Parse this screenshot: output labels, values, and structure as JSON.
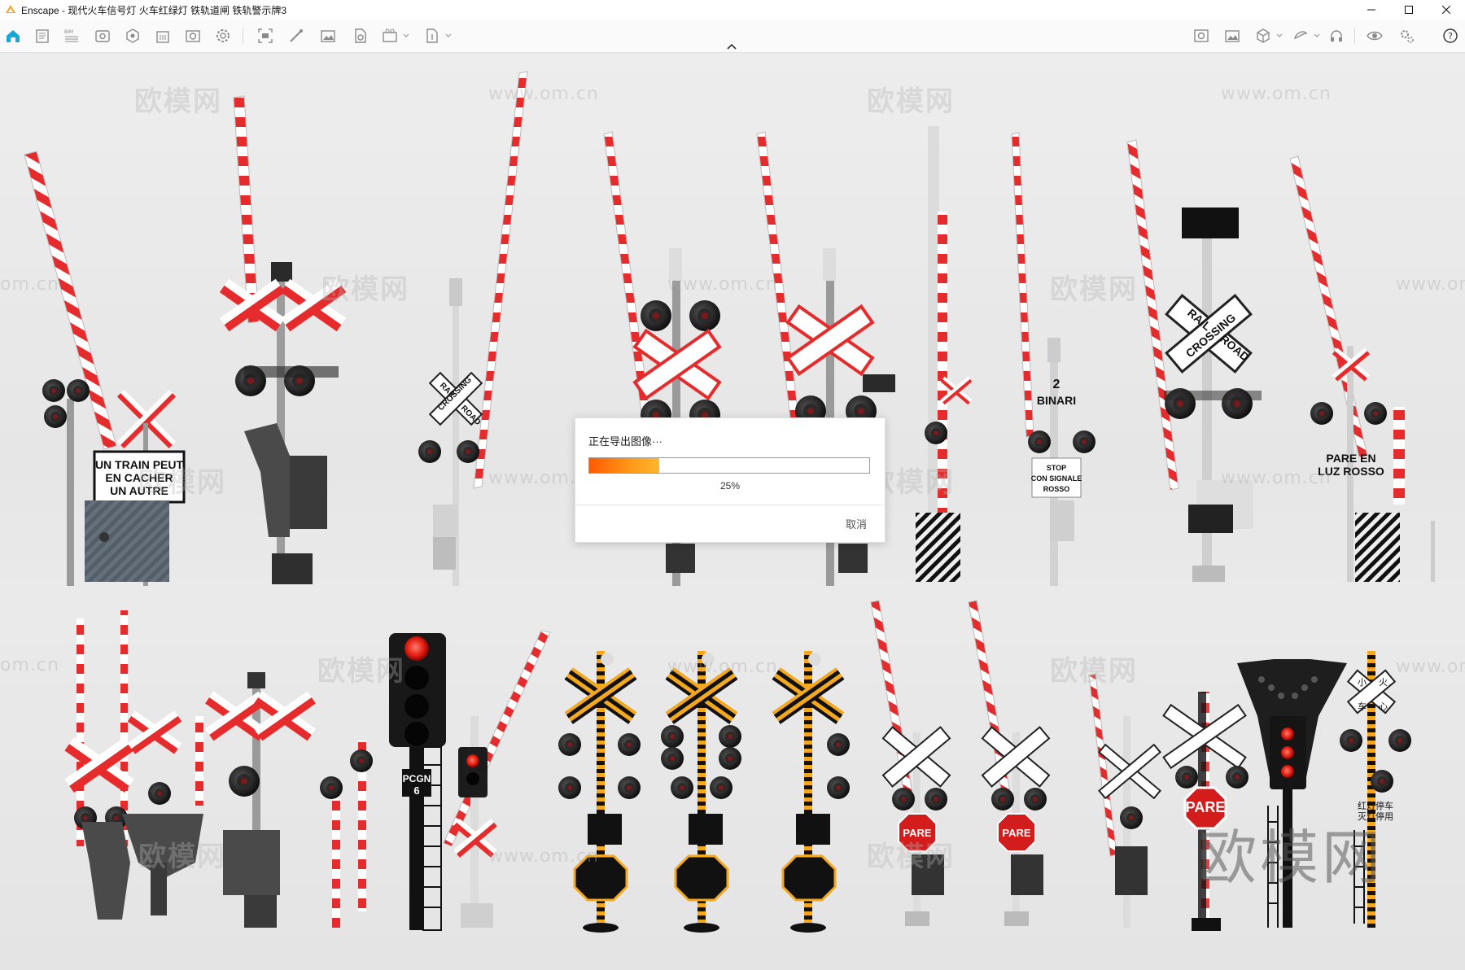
{
  "window": {
    "app_name": "Enscape",
    "title": "Enscape - 现代火车信号灯 火车红绿灯 铁轨道闸 铁轨警示牌3",
    "controls": [
      "minimize-icon",
      "maximize-icon",
      "close-icon"
    ]
  },
  "toolbar": {
    "left_icons": [
      "home-icon",
      "asset-library-icon",
      "bim-info-icon",
      "views-icon",
      "atmosphere-icon",
      "building-icon",
      "visual-settings-icon",
      "settings-gear-icon",
      "capture-icon",
      "draw-icon",
      "screenshot-icon",
      "batch-render-icon",
      "video-icon",
      "export-icon"
    ],
    "center_icon": "collapse-chevron-up-icon",
    "right_icons": [
      "material-editor-icon",
      "image-icon",
      "view-cube-icon",
      "vr-icon",
      "headset-icon",
      "visibility-eye-icon",
      "settings-icon",
      "help-icon"
    ]
  },
  "scene": {
    "signs": {
      "fr_sign": [
        "UN TRAIN PEUT",
        "EN CACHER",
        "UN AUTRE"
      ],
      "crossbuck_small": [
        "RAIL",
        "CROSSING",
        "ROAD"
      ],
      "crossbuck_large": [
        "RAIL",
        "CROSSING",
        "ROAD"
      ],
      "binari_number": "2",
      "binari_label": "BINARI",
      "stop_sign": [
        "STOP",
        "CON SIGNALE",
        "ROSSO"
      ],
      "pare_sign": [
        "PARE EN",
        "LUZ ROSSO"
      ],
      "pcgn_label": "PCGN",
      "pcgn_number": "6",
      "pare_octagon": "PARE",
      "cn_sign_1": [
        "红灯停车",
        "灭灯停用"
      ],
      "cn_cross_chars": [
        "小",
        "火",
        "车",
        "心"
      ]
    },
    "watermarks": {
      "brand": "欧模网",
      "url": "www.om.cn",
      "partial_url": "om.cn"
    }
  },
  "dialog": {
    "title": "正在导出图像···",
    "progress": 0.25,
    "percent_label": "25%",
    "cancel_label": "取消"
  },
  "colors": {
    "progress_start": "#ff5a00",
    "progress_end": "#ffb52e",
    "stripe_red": "#e52b2b",
    "stripe_white": "#ffffff",
    "lamp_black": "#151515",
    "amber_stripe": "#f4a81d",
    "home_icon": "#19a7d6"
  }
}
